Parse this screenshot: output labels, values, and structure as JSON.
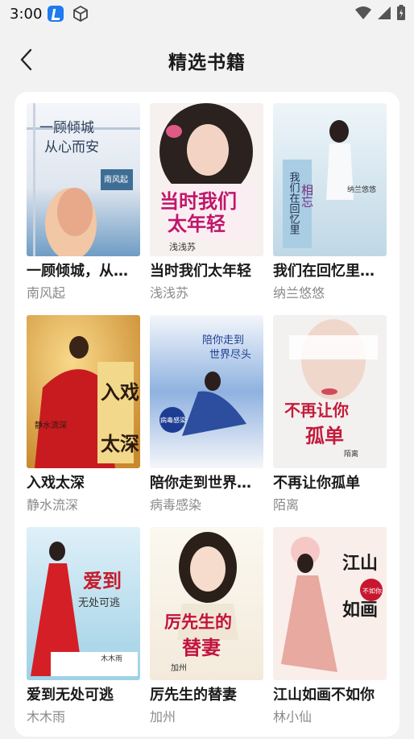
{
  "status_bar": {
    "time": "3:00",
    "icons": [
      "app-notification-icon",
      "cube-icon",
      "wifi-icon",
      "signal-icon",
      "battery-icon"
    ]
  },
  "header": {
    "title": "精选书籍",
    "back_icon": "chevron-left-icon"
  },
  "books": [
    {
      "title": "一顾倾城，从心而安",
      "author": "南风起",
      "cover_text": [
        "一顾倾城",
        "从心而安",
        "南风起"
      ]
    },
    {
      "title": "当时我们太年轻",
      "author": "浅浅苏",
      "cover_text": [
        "当时我们",
        "太年轻",
        "浅浅苏"
      ]
    },
    {
      "title": "我们在回忆里相忘",
      "author": "纳兰悠悠",
      "cover_text": [
        "我们在回忆里",
        "相忘",
        "纳兰悠悠"
      ]
    },
    {
      "title": "入戏太深",
      "author": "静水流深",
      "cover_text": [
        "入戏",
        "太深",
        "静水流深"
      ]
    },
    {
      "title": "陪你走到世界尽头",
      "author": "病毒感染",
      "cover_text": [
        "陪你走到",
        "世界尽头",
        "病毒感染"
      ]
    },
    {
      "title": "不再让你孤单",
      "author": "陌离",
      "cover_text": [
        "不再让你",
        "孤单",
        "陌离"
      ]
    },
    {
      "title": "爱到无处可逃",
      "author": "木木雨",
      "cover_text": [
        "爱到",
        "无处可逃",
        "木木雨"
      ]
    },
    {
      "title": "厉先生的替妻",
      "author": "加州",
      "cover_text": [
        "厉先生的",
        "替妻",
        "加州"
      ]
    },
    {
      "title": "江山如画不如你",
      "author": "林小仙",
      "cover_text": [
        "江山",
        "如画",
        "不如你"
      ]
    }
  ],
  "colors": {
    "background": "#f2f2f2",
    "panel": "#ffffff",
    "title_text": "#1a1a1a",
    "author_text": "#8a8a8a"
  }
}
